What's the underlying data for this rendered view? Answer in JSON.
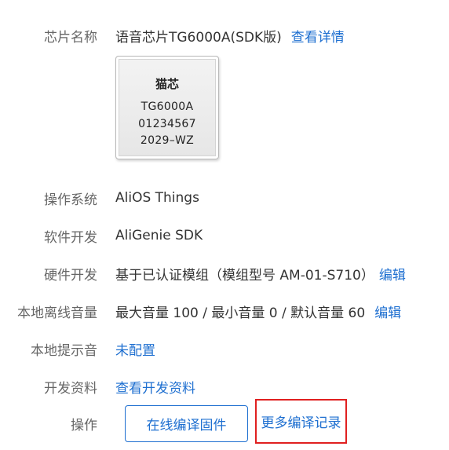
{
  "chip_name": {
    "label": "芯片名称",
    "value": "语音芯片TG6000A(SDK版)",
    "link": "查看详情"
  },
  "chip_image": {
    "brand": "猫芯",
    "model": "TG6000A",
    "serial": "01234567",
    "date_code": "2029–WZ"
  },
  "os": {
    "label": "操作系统",
    "value": "AliOS Things"
  },
  "software": {
    "label": "软件开发",
    "value": "AliGenie SDK"
  },
  "hardware": {
    "label": "硬件开发",
    "value": "基于已认证模组（模组型号 AM-01-S710）",
    "link": "编辑"
  },
  "volume": {
    "label": "本地离线音量",
    "value": "最大音量 100 / 最小音量 0 / 默认音量 60",
    "link": "编辑"
  },
  "prompt_tone": {
    "label": "本地提示音",
    "link": "未配置"
  },
  "dev_docs": {
    "label": "开发资料",
    "link": "查看开发资料"
  },
  "actions": {
    "label": "操作",
    "compile_button": "在线编译固件",
    "more_records": "更多编译记录"
  },
  "colors": {
    "link": "#1e6fd0",
    "label": "#666666",
    "text": "#333333",
    "highlight_border": "#e02020"
  }
}
